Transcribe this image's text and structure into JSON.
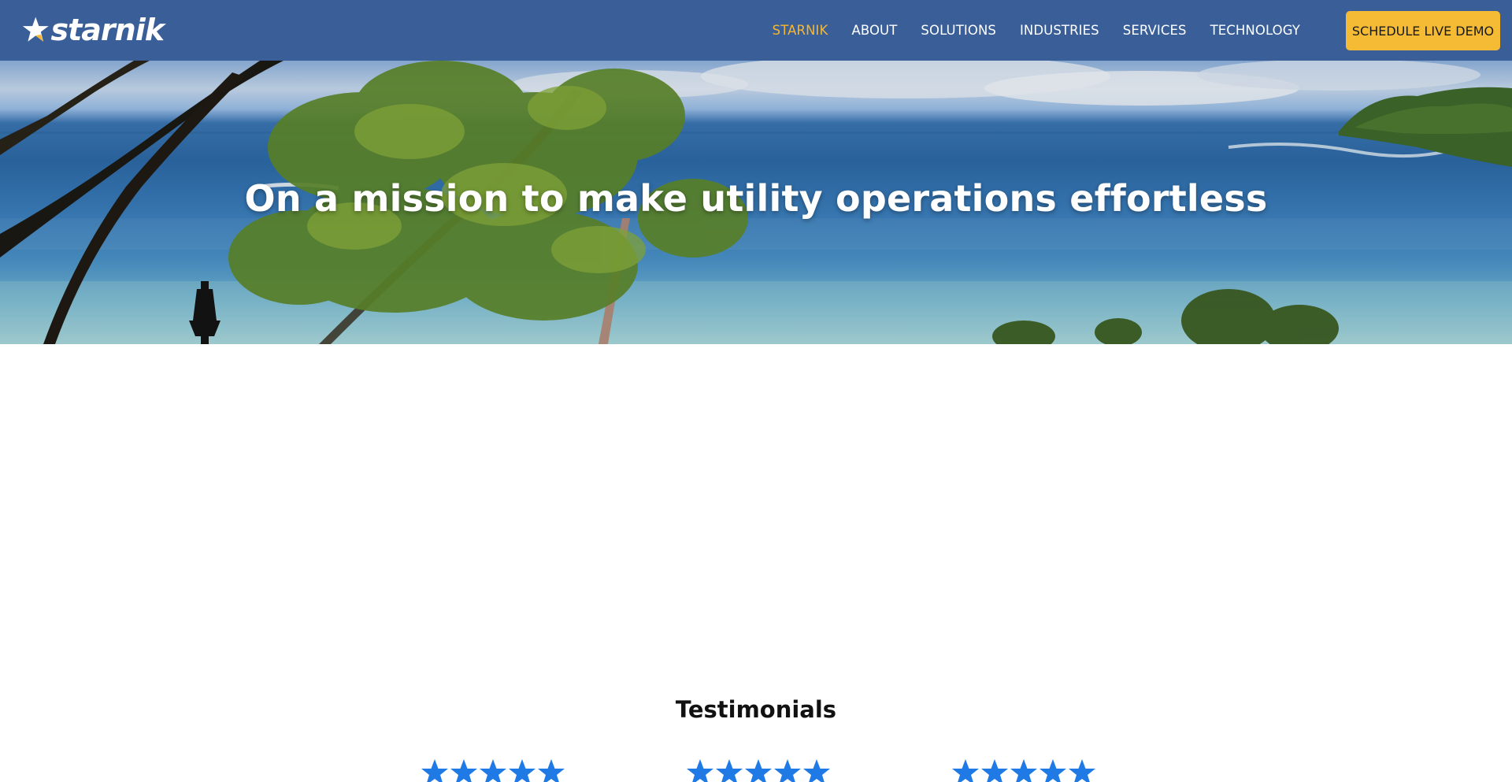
{
  "header": {
    "logo_text": "starnik",
    "nav": [
      "STARNIK",
      "ABOUT",
      "SOLUTIONS",
      "INDUSTRIES",
      "SERVICES",
      "TECHNOLOGY"
    ],
    "active_nav": "STARNIK",
    "cta_label": "SCHEDULE LIVE DEMO"
  },
  "hero": {
    "title": "On a mission to make utility operations effortless"
  },
  "testimonials": {
    "title": "Testimonials",
    "ratings": [
      5,
      5,
      5
    ]
  },
  "colors": {
    "header_bg": "#3a5f98",
    "accent": "#f5b731",
    "star": "#1f7ae6"
  },
  "icons": {
    "logo": "star-icon",
    "rating": "star-icon"
  }
}
